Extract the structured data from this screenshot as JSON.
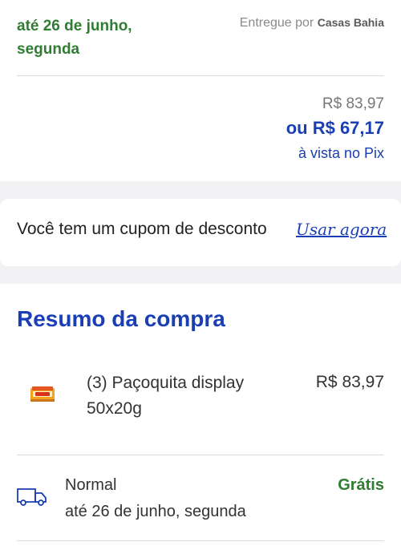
{
  "delivery": {
    "date": "até 26 de junho, segunda",
    "delivered_by_label": "Entregue por",
    "seller": "Casas Bahia"
  },
  "pricing": {
    "original_price": "R$ 83,97",
    "pix_price": "ou R$ 67,17",
    "pix_note": "à vista no Pix"
  },
  "coupon": {
    "message": "Você tem um cupom de desconto",
    "action_label": "Usar agora"
  },
  "summary": {
    "title": "Resumo da compra",
    "product": {
      "name": "(3) Paçoquita display 50x20g",
      "price": "R$ 83,97",
      "image_icon": "product-box-image"
    },
    "shipping": {
      "icon": "truck-icon",
      "method": "Normal",
      "date": "até 26 de junho, segunda",
      "price": "Grátis"
    }
  },
  "colors": {
    "green": "#2f7d32",
    "blue": "#1a3fb5"
  }
}
